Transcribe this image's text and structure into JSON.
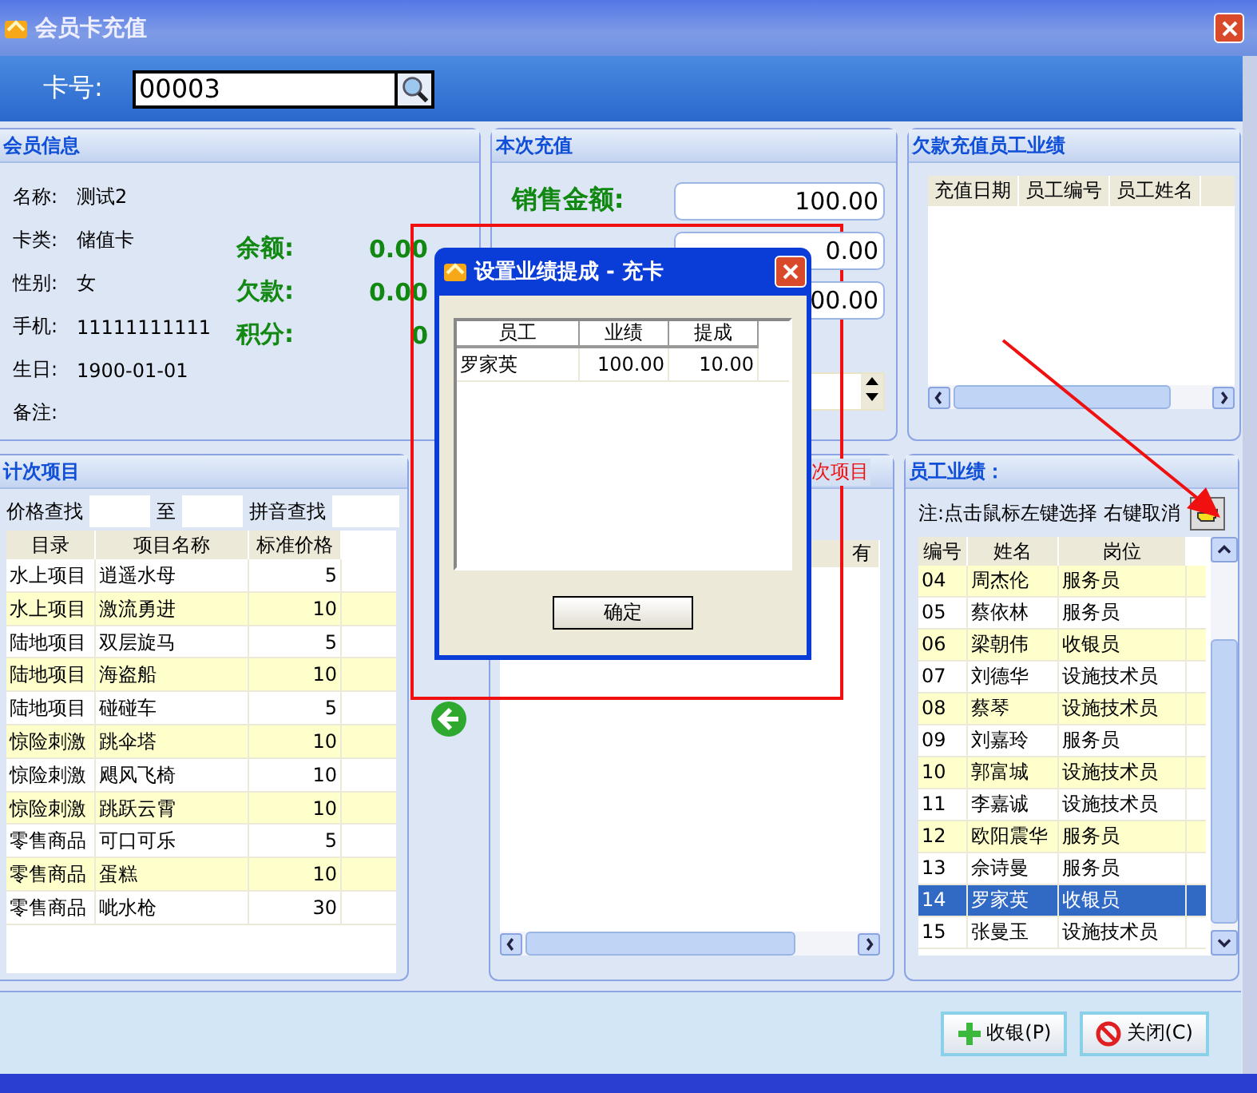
{
  "window": {
    "title": "会员卡充值"
  },
  "card": {
    "label": "卡号:",
    "value": "00003"
  },
  "member_info": {
    "title": "会员信息",
    "fields": [
      {
        "label": "名称:",
        "value": "测试2"
      },
      {
        "label": "卡类:",
        "value": "储值卡"
      },
      {
        "label": "性别:",
        "value": "女"
      },
      {
        "label": "手机:",
        "value": "11111111111"
      },
      {
        "label": "生日:",
        "value": "1900-01-01"
      },
      {
        "label": "备注:"
      }
    ],
    "balances": [
      {
        "label": "余额:",
        "value": "0.00"
      },
      {
        "label": "欠款:",
        "value": "0.00"
      },
      {
        "label": "积分:",
        "value": "0"
      }
    ]
  },
  "recharge": {
    "title": "本次充值",
    "rows": [
      {
        "label": "销售金额:",
        "value": "100.00"
      },
      {
        "value": "0.00"
      },
      {
        "value": "00.00"
      }
    ]
  },
  "arrears_staff": {
    "title": "欠款充值员工业绩",
    "columns": [
      "充值日期",
      "员工编号",
      "员工姓名"
    ]
  },
  "count_items": {
    "title": "计次项目",
    "search_labels": [
      "价格查找",
      "至",
      "拼音查找"
    ],
    "columns": [
      "目录",
      "项目名称",
      "标准价格"
    ],
    "rows": [
      [
        "水上项目",
        "逍遥水母",
        "5"
      ],
      [
        "水上项目",
        "激流勇进",
        "10"
      ],
      [
        "陆地项目",
        "双层旋马",
        "5"
      ],
      [
        "陆地项目",
        "海盗船",
        "10"
      ],
      [
        "陆地项目",
        "碰碰车",
        "5"
      ],
      [
        "惊险刺激",
        "跳伞塔",
        "10"
      ],
      [
        "惊险刺激",
        "飓风飞椅",
        "10"
      ],
      [
        "惊险刺激",
        "跳跃云霄",
        "10"
      ],
      [
        "零售商品",
        "可口可乐",
        "5"
      ],
      [
        "零售商品",
        "蛋糕",
        "10"
      ],
      [
        "零售商品",
        "呲水枪",
        "30"
      ]
    ]
  },
  "selected_items": {
    "title": "次项目",
    "columns": [
      "有"
    ]
  },
  "staff": {
    "title": "员工业绩：",
    "note": "注:点击鼠标左键选择 右键取消",
    "columns": [
      "编号",
      "姓名",
      "岗位"
    ],
    "rows": [
      {
        "cells": [
          "04",
          "周杰伦",
          "服务员"
        ],
        "selected": false
      },
      {
        "cells": [
          "05",
          "蔡依林",
          "服务员"
        ],
        "selected": false
      },
      {
        "cells": [
          "06",
          "梁朝伟",
          "收银员"
        ],
        "selected": false
      },
      {
        "cells": [
          "07",
          "刘德华",
          "设施技术员"
        ],
        "selected": false
      },
      {
        "cells": [
          "08",
          "蔡琴",
          "设施技术员"
        ],
        "selected": false
      },
      {
        "cells": [
          "09",
          "刘嘉玲",
          "服务员"
        ],
        "selected": false
      },
      {
        "cells": [
          "10",
          "郭富城",
          "设施技术员"
        ],
        "selected": false
      },
      {
        "cells": [
          "11",
          "李嘉诚",
          "设施技术员"
        ],
        "selected": false
      },
      {
        "cells": [
          "12",
          "欧阳震华",
          "服务员"
        ],
        "selected": false
      },
      {
        "cells": [
          "13",
          "佘诗曼",
          "服务员"
        ],
        "selected": false
      },
      {
        "cells": [
          "14",
          "罗家英",
          "收银员"
        ],
        "selected": true
      },
      {
        "cells": [
          "15",
          "张曼玉",
          "设施技术员"
        ],
        "selected": false
      }
    ]
  },
  "footer": {
    "buttons": [
      {
        "label": "收银(P)",
        "kind": "add"
      },
      {
        "label": "关闭(C)",
        "kind": "close"
      }
    ]
  },
  "dialog": {
    "title": "设置业绩提成 - 充卡",
    "columns": [
      "员工",
      "业绩",
      "提成"
    ],
    "rows": [
      [
        "罗家英",
        "100.00",
        "10.00"
      ]
    ],
    "button": "确定"
  }
}
